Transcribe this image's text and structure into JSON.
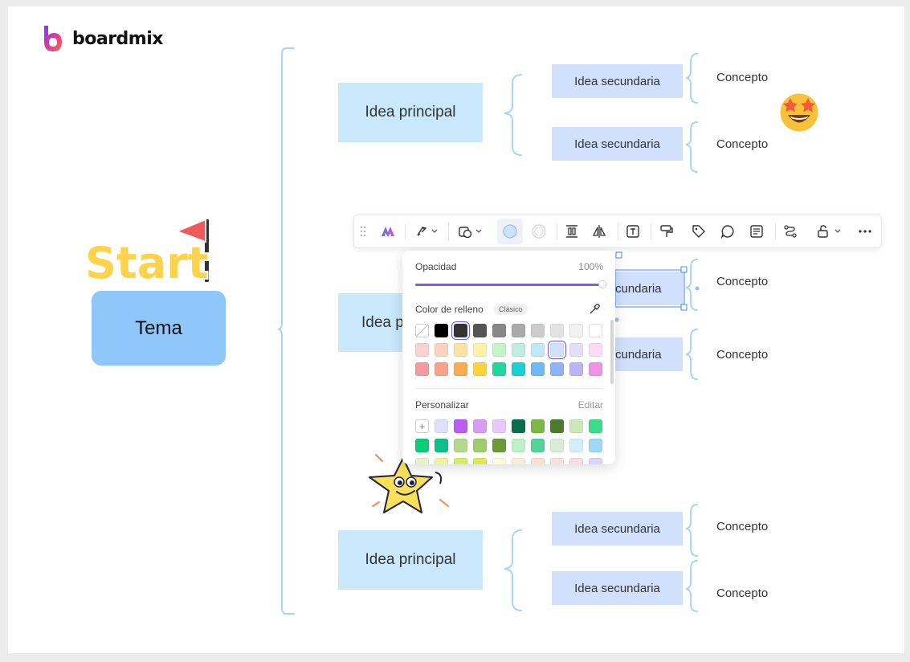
{
  "app": {
    "name": "boardmix"
  },
  "mindmap": {
    "root": "Tema",
    "sticker": "Start",
    "main_ideas": [
      "Idea principal",
      "Idea p",
      "Idea principal"
    ],
    "secondary": [
      "Idea secundaria",
      "Idea secundaria",
      "cundaria",
      "cundaria",
      "Idea secundaria",
      "Idea secundaria"
    ],
    "concepts": [
      "Concepto",
      "Concepto",
      "Concepto",
      "Concepto",
      "Concepto",
      "Concepto"
    ]
  },
  "toolbar": {
    "items": [
      "drag-handle-icon",
      "ai-icon",
      "style-icon",
      "shape-icon",
      "fill-color-icon",
      "border-color-icon",
      "align-icon",
      "flip-icon",
      "text-icon",
      "format-painter-icon",
      "tag-icon",
      "comment-icon",
      "note-icon",
      "connector-icon",
      "lock-icon",
      "more-icon"
    ],
    "fill_color": "#d1e0fc"
  },
  "color_panel": {
    "opacity_label": "Opacidad",
    "opacity_value": "100%",
    "opacity": 1.0,
    "fill_label": "Color de relleno",
    "palette_badge": "Clásico",
    "custom_label": "Personalizar",
    "edit_label": "Editar",
    "add_symbol": "+",
    "classic_rows": [
      [
        "none",
        "#000000",
        "#333333",
        "#555555",
        "#888888",
        "#aaaaaa",
        "#cccccc",
        "#e3e3e3",
        "#f2f2f2",
        "#ffffff"
      ],
      [
        "#fdd0d4",
        "#fdd2bf",
        "#fde2a6",
        "#fdf3a8",
        "#c3f5c9",
        "#bdeee0",
        "#bfe8fa",
        "#d1e0fc",
        "#e3defd",
        "#fadcf3"
      ],
      [
        "#f79a9f",
        "#f9a388",
        "#f9ad4f",
        "#fcd43a",
        "#22d6a0",
        "#18d2d6",
        "#6fb9f5",
        "#8fb3f8",
        "#bdb3f8",
        "#f193e5"
      ]
    ],
    "custom_rows": [
      [
        "add",
        "#e0e0fc",
        "#bb5cf2",
        "#d99cf2",
        "#e8c8f8",
        "#0a6e4b",
        "#7ab848",
        "#4e7a2e",
        "#cde8b8",
        "#3ddc8a"
      ],
      [
        "#0ccc78",
        "#0ebf8c",
        "#b5d88f",
        "#a0cc70",
        "#6b9a38",
        "#bdf2c8",
        "#55d39a",
        "#d7edd5",
        "#d3eefa",
        "#9cdaf8"
      ],
      [
        "#e7f3c6",
        "#eef59e",
        "#d8ec6a",
        "#dcea52",
        "#fffbe0",
        "#fbeedd",
        "#fbe0d8",
        "#fae0e0",
        "#f7dbe6",
        "#dcd5fb"
      ]
    ]
  }
}
